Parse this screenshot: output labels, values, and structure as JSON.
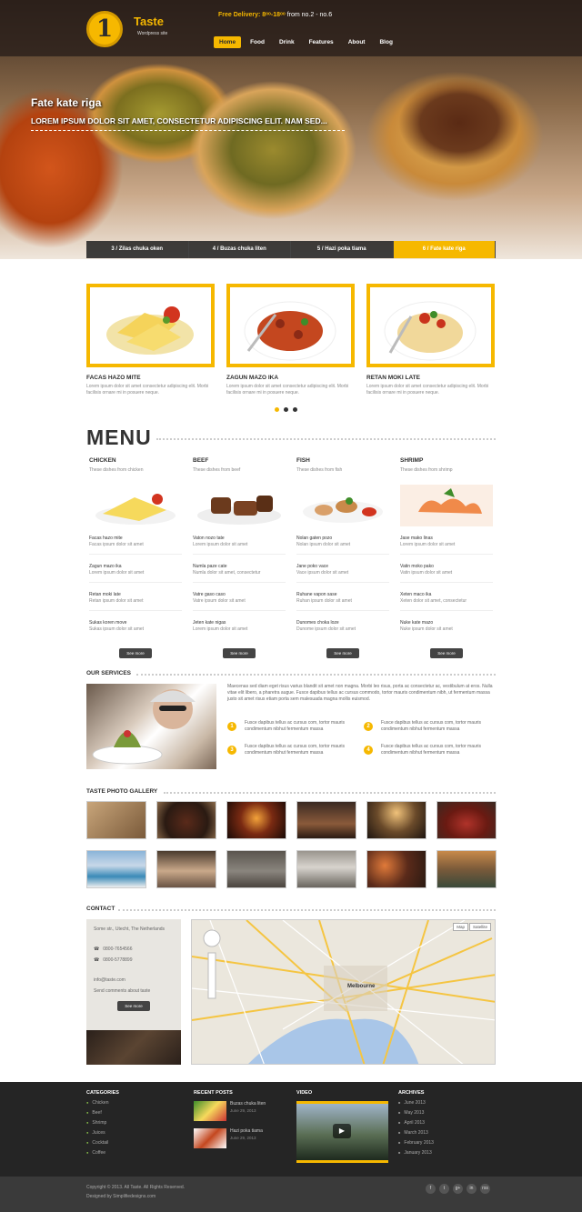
{
  "header": {
    "logo_mark": "1",
    "brand": "Taste",
    "tagline": "Wordpress site",
    "delivery_label": "Free Delivery: 8ᵒᵒ-18ᵒᵒ",
    "delivery_days": "from no.2 - no.6",
    "nav": [
      "Home",
      "Food",
      "Drink",
      "Features",
      "About",
      "Blog"
    ]
  },
  "hero": {
    "title": "Fate kate riga",
    "subtitle": "LOREM IPSUM DOLOR SIT AMET, CONSECTETUR ADIPISCING ELIT. NAM SED...",
    "tabs": [
      "3 / Zilas chuka oken",
      "4 / Buzas chuka liten",
      "5 / Hazi poka tiama",
      "6 / Fate kate riga"
    ]
  },
  "features": [
    {
      "title": "FACAS HAZO MITE",
      "text": "Lorem ipsum dolor sit amet consectetur adipiscing elit. Morbi facilisis ornare mi in posuere neque."
    },
    {
      "title": "ZAGUN MAZO IKA",
      "text": "Lorem ipsum dolor sit amet consectetur adipiscing elit. Morbi facilisis ornare mi in posuere neque."
    },
    {
      "title": "RETAN MOKI LATE",
      "text": "Lorem ipsum dolor sit amet consectetur adipiscing elit. Morbi facilisis ornare mi in posuere neque."
    }
  ],
  "menu": {
    "title": "MENU",
    "see_more": "See more",
    "columns": [
      {
        "name": "CHICKEN",
        "sub": "These dishes from chicken",
        "items": [
          [
            "Facas hazo mite",
            "Facas ipsum dolor sit amet"
          ],
          [
            "Zagun mazo ika",
            "Lorem ipsum dolor sit amet"
          ],
          [
            "Retan moki late",
            "Retan ipsum dolor sit amet"
          ],
          [
            "Sukas koren move",
            "Sukas ipsum dolor sit amet"
          ]
        ]
      },
      {
        "name": "BEEF",
        "sub": "These dishes from beef",
        "items": [
          [
            "Vaton nozo tate",
            "Lorem ipsum dolor sit amet"
          ],
          [
            "Numla paze cate",
            "Numla dolor sit amet, consectetur"
          ],
          [
            "Vatre gaso caso",
            "Vatre ipsum dolor sit amet"
          ],
          [
            "Jeten kate nigas",
            "Lorem ipsum dolor sit amet"
          ]
        ]
      },
      {
        "name": "FISH",
        "sub": "These dishes from fish",
        "items": [
          [
            "Nolan gaten pozo",
            "Nolan ipsum dolor sit amet"
          ],
          [
            "Jane poko vace",
            "Vace ipsum dolor sit amet"
          ],
          [
            "Ruhane vapon sase",
            "Ruhan ipsum dolor sit amet"
          ],
          [
            "Dunomes choka loze",
            "Dunome ipsum dolor sit amet"
          ]
        ]
      },
      {
        "name": "SHRIMP",
        "sub": "These dishes from shrimp",
        "items": [
          [
            "Jase mako linas",
            "Lorem ipsum dolor sit amet"
          ],
          [
            "Vatin moko pako",
            "Vatin ipsum dolor sit amet"
          ],
          [
            "Xeten maco ika",
            "Xeten dolor sit amet, consectetur"
          ],
          [
            "Nuke kate mazo",
            "Nuke ipsum dolor sit amet"
          ]
        ]
      }
    ]
  },
  "services": {
    "title": "OUR SERVICES",
    "text": "Maecenas sed diam eget risus varius blandit sit amet non magna. Morbi leo risus, porta ac consectetur ac, vestibulum at eros. Nulla vitae elit libero, a pharetra augue. Fusce dapibus tellus ac cursus commodo, tortor mauris condimentum nibh, ut fermentum massa justo sit amet risus etiam porta sem malesuada magna mollis euismod.",
    "items": [
      {
        "num": "1",
        "text": "Fusce dapibus tellus ac cursus com, tortor mauris condimentum nibhut fermentum massa"
      },
      {
        "num": "2",
        "text": "Fusce dapibus tellus ac cursus com, tortor mauris condimentum nibhut fermentum massa"
      },
      {
        "num": "3",
        "text": "Fusce dapibus tellus ac cursus com, tortor mauris condimentum nibhut fermentum massa"
      },
      {
        "num": "4",
        "text": "Fusce dapibus tellus ac cursus com, tortor mauris condimentum nibhut fermentum massa"
      }
    ]
  },
  "gallery": {
    "title": "TASTE PHOTO GALLERY"
  },
  "contact": {
    "title": "CONTACT",
    "address": "Some str., Utecht, The Netherlands",
    "phone1": "0800-7654566",
    "phone2": "0800-5778899",
    "email": "info@taste.com",
    "note": "Send comments about taste",
    "see_more": "See more",
    "map_tabs": [
      "Map",
      "Satellite"
    ],
    "map_city": "Melbourne"
  },
  "footer": {
    "categories_title": "CATEGORIES",
    "categories": [
      "Chicken",
      "Beef",
      "Shrimp",
      "Juices",
      "Cocktail",
      "Coffee"
    ],
    "recent_title": "RECENT POSTS",
    "recent": [
      [
        "Buzas chuka liten",
        "June 29, 2013"
      ],
      [
        "Hazi poka tiama",
        "June 29, 2013"
      ]
    ],
    "video_title": "VIDEO",
    "archives_title": "ARCHIVES",
    "archives": [
      "June 2013",
      "May 2013",
      "April 2013",
      "March 2013",
      "February 2013",
      "January 2013"
    ],
    "copyright": "Copyright © 2013. All Taste. All Rights Reserved.",
    "designed": "Designed by Simplifiedesigns.com",
    "social": [
      "f",
      "t",
      "g+",
      "in",
      "rss"
    ]
  },
  "colors": {
    "accent": "#f6b800",
    "dark": "#252525"
  }
}
